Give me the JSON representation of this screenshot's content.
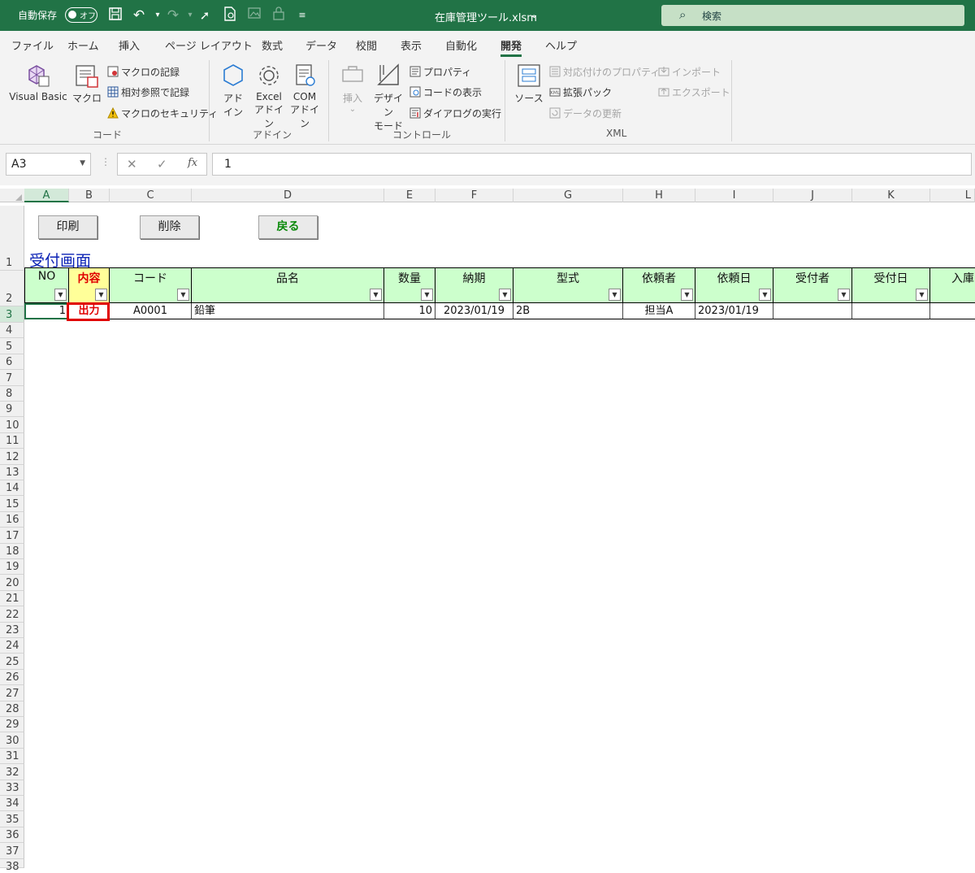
{
  "titlebar": {
    "autosave_label": "自動保存",
    "toggle_text": "オフ",
    "filename": "在庫管理ツール.xlsm",
    "search_placeholder": "検索",
    "bg_color": "#217346"
  },
  "ribbon": {
    "tabs": [
      "ファイル",
      "ホーム",
      "挿入",
      "ページ レイアウト",
      "数式",
      "データ",
      "校閲",
      "表示",
      "自動化",
      "開発",
      "ヘルプ"
    ],
    "active_tab": "開発",
    "groups": {
      "code": {
        "label": "コード",
        "visual_basic": "Visual Basic",
        "macro": "マクロ",
        "record_macro": "マクロの記録",
        "relative_ref": "相対参照で記録",
        "macro_security": "マクロのセキュリティ"
      },
      "addins": {
        "label": "アドイン",
        "addin_l1": "アド",
        "addin_l2": "イン",
        "excel_l1": "Excel",
        "excel_l2": "アドイン",
        "com_l1": "COM",
        "com_l2": "アドイン"
      },
      "controls": {
        "label": "コントロール",
        "insert": "挿入",
        "design_l1": "デザイン",
        "design_l2": "モード",
        "properties": "プロパティ",
        "view_code": "コードの表示",
        "run_dialog": "ダイアログの実行"
      },
      "xml": {
        "label": "XML",
        "source": "ソース",
        "map_properties": "対応付けのプロパティ",
        "expansion_packs": "拡張パック",
        "refresh_data": "データの更新",
        "import": "インポート",
        "export": "エクスポート"
      }
    }
  },
  "formula_bar": {
    "name_box": "A3",
    "formula": "1",
    "fx": "fx"
  },
  "grid": {
    "columns": [
      "A",
      "B",
      "C",
      "D",
      "E",
      "F",
      "G",
      "H",
      "I",
      "J",
      "K",
      "L"
    ],
    "selected_column": "A",
    "selected_row": "3",
    "rows": [
      "1",
      "2",
      "3",
      "4",
      "5",
      "6",
      "7",
      "8",
      "9",
      "10",
      "11",
      "12",
      "13",
      "14",
      "15",
      "16",
      "17",
      "18",
      "19",
      "20",
      "21",
      "22",
      "23",
      "24",
      "25",
      "26",
      "27",
      "28",
      "29",
      "30",
      "31",
      "32",
      "33",
      "34",
      "35",
      "36",
      "37",
      "38"
    ]
  },
  "sheet": {
    "buttons": {
      "print": "印刷",
      "delete": "削除",
      "back": "戻る"
    },
    "title": "受付画面",
    "headers": [
      "NO",
      "内容",
      "コード",
      "品名",
      "数量",
      "納期",
      "型式",
      "依頼者",
      "依頼日",
      "受付者",
      "受付日",
      "入庫"
    ],
    "row": [
      "1",
      "出力",
      "A0001",
      "鉛筆",
      "10",
      "2023/01/19",
      "2B",
      "担当A",
      "2023/01/19",
      "",
      "",
      ""
    ],
    "header_fill": "#ccffcc",
    "highlight_fill": "#ffff99",
    "highlight_text": "#e00000"
  }
}
